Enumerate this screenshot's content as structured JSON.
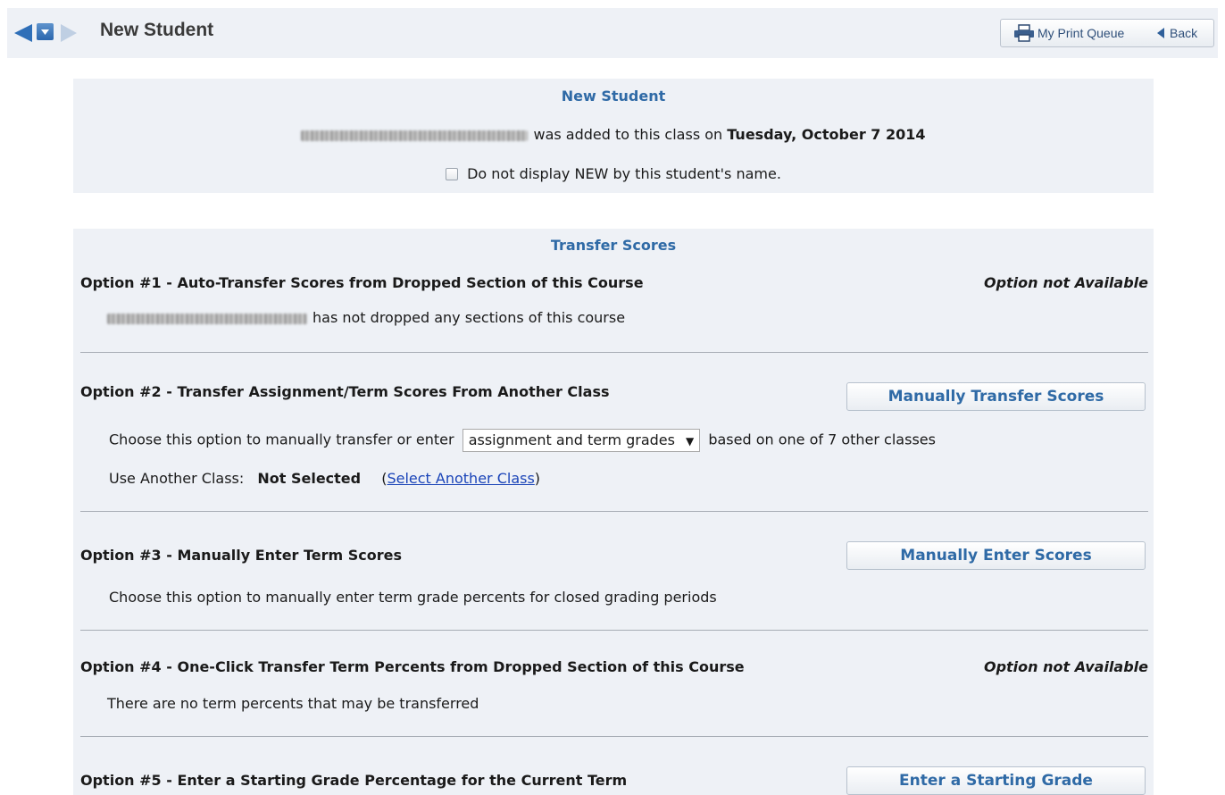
{
  "header": {
    "title": "New Student",
    "print_queue_label": "My Print Queue",
    "back_label": "Back"
  },
  "new_student_panel": {
    "title": "New Student",
    "added_text": "was added to this class on",
    "added_date": "Tuesday, October 7 2014",
    "checkbox_label": "Do not display NEW by this student's name.",
    "checkbox_checked": false
  },
  "transfer_panel": {
    "title": "Transfer Scores",
    "option1": {
      "title": "Option #1 - Auto-Transfer Scores from Dropped Section of this Course",
      "status": "Option not Available",
      "desc": "has not dropped any sections of this course"
    },
    "option2": {
      "title": "Option #2 - Transfer Assignment/Term Scores From Another Class",
      "button": "Manually Transfer Scores",
      "desc_before": "Choose this option to manually transfer or enter",
      "select_value": "assignment and term grades",
      "desc_after": "based on one of 7 other classes",
      "another_class_label": "Use Another Class:",
      "another_class_value": "Not Selected",
      "select_link": "Select Another Class",
      "paren_open": "(",
      "paren_close": ")"
    },
    "option3": {
      "title": "Option #3 - Manually Enter Term Scores",
      "button": "Manually Enter Scores",
      "desc": "Choose this option to manually enter term grade percents for closed grading periods"
    },
    "option4": {
      "title": "Option #4 - One-Click Transfer Term Percents from Dropped Section of this Course",
      "status": "Option not Available",
      "desc": "There are no term percents that may be transferred"
    },
    "option5": {
      "title": "Option #5 - Enter a Starting Grade Percentage for the Current Term",
      "button": "Enter a Starting Grade"
    }
  },
  "icons": {
    "nav_back": "triangle-left-icon",
    "nav_menu": "dropdown-square-icon",
    "nav_forward": "triangle-right-icon",
    "print": "printer-icon",
    "back": "triangle-left-icon"
  },
  "colors": {
    "panel_bg": "#eef1f6",
    "title_blue": "#2f6aa6",
    "link_blue": "#1a44b8",
    "nav_blue": "#2c67ae"
  }
}
